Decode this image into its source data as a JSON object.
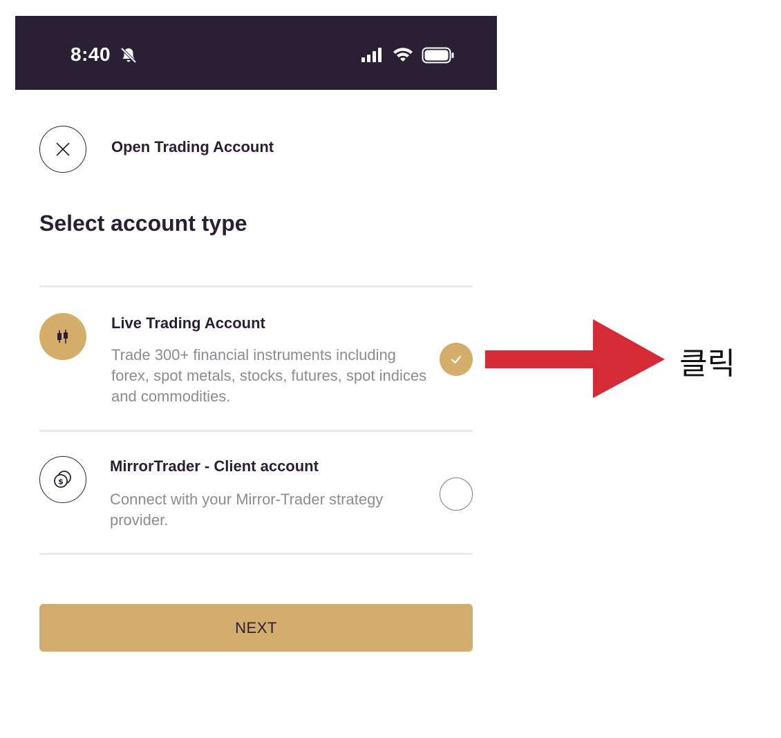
{
  "status_bar": {
    "time": "8:40",
    "icons": [
      "bell-slash-icon",
      "cellular-signal-icon",
      "wifi-icon",
      "battery-icon"
    ]
  },
  "header": {
    "title": "Open Trading Account",
    "close_icon": "close-icon"
  },
  "section_title": "Select account type",
  "options": [
    {
      "title": "Live Trading Account",
      "description": "Trade 300+ financial instruments including forex, spot metals, stocks, futures, spot indices and commodities.",
      "icon": "candlestick-icon",
      "selected": true
    },
    {
      "title": "MirrorTrader - Client account",
      "description": "Connect with your Mirror-Trader strategy provider.",
      "icon": "coins-icon",
      "selected": false
    }
  ],
  "next_button": {
    "label": "NEXT"
  },
  "annotation": {
    "text": "클릭"
  },
  "colors": {
    "status_bar_bg": "#2a2036",
    "accent_gold": "#d4ad6a",
    "text_dark": "#2a2036",
    "text_muted": "#8d8b92",
    "divider": "#e9e9ec",
    "annotation_red": "#d42b37"
  }
}
